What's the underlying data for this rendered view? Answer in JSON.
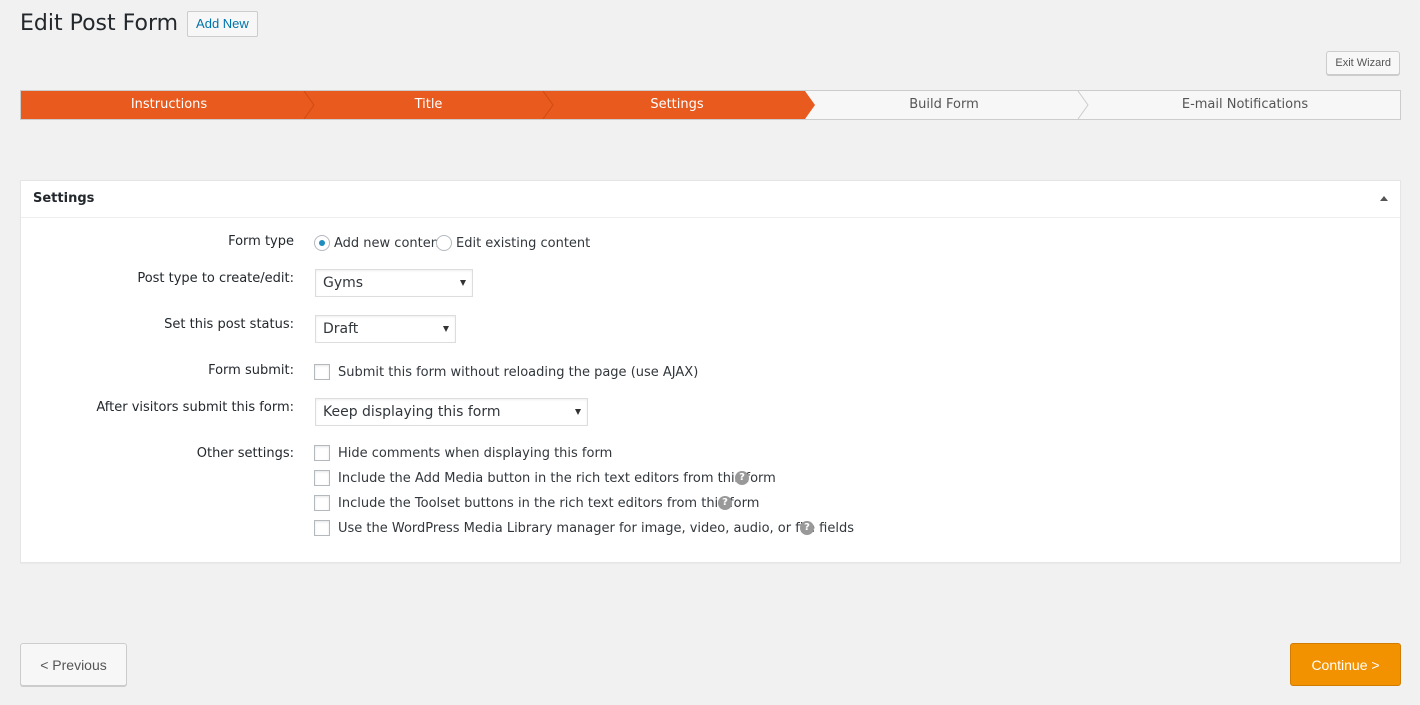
{
  "header": {
    "title": "Edit Post Form",
    "add_new_label": "Add New"
  },
  "wizard": {
    "exit_label": "Exit Wizard",
    "steps": [
      {
        "label": "Instructions",
        "active": true
      },
      {
        "label": "Title",
        "active": true
      },
      {
        "label": "Settings",
        "active": true
      },
      {
        "label": "Build Form",
        "active": false
      },
      {
        "label": "E-mail Notifications",
        "active": false
      }
    ],
    "active_color": "#e85a1e"
  },
  "panel": {
    "title": "Settings",
    "form_type": {
      "label": "Form type",
      "options": [
        "Add new content",
        "Edit existing content"
      ],
      "selected": "Add new content"
    },
    "post_type": {
      "label": "Post type to create/edit:",
      "value": "Gyms"
    },
    "post_status": {
      "label": "Set this post status:",
      "value": "Draft"
    },
    "form_submit": {
      "label": "Form submit:",
      "option": "Submit this form without reloading the page (use AJAX)",
      "checked": false
    },
    "after_submit": {
      "label": "After visitors submit this form:",
      "value": "Keep displaying this form"
    },
    "other_settings": {
      "label": "Other settings:",
      "options": [
        {
          "text": "Hide comments when displaying this form",
          "checked": false,
          "help": false
        },
        {
          "text": "Include the Add Media button in the rich text editors from this form",
          "checked": false,
          "help": true
        },
        {
          "text": "Include the Toolset buttons in the rich text editors from this form",
          "checked": false,
          "help": true
        },
        {
          "text": "Use the WordPress Media Library manager for image, video, audio, or file fields",
          "checked": false,
          "help": true
        }
      ]
    }
  },
  "footer": {
    "previous_label": "< Previous",
    "continue_label": "Continue >"
  },
  "colors": {
    "accent": "#e85a1e",
    "continue": "#f39200",
    "link": "#0073aa"
  }
}
